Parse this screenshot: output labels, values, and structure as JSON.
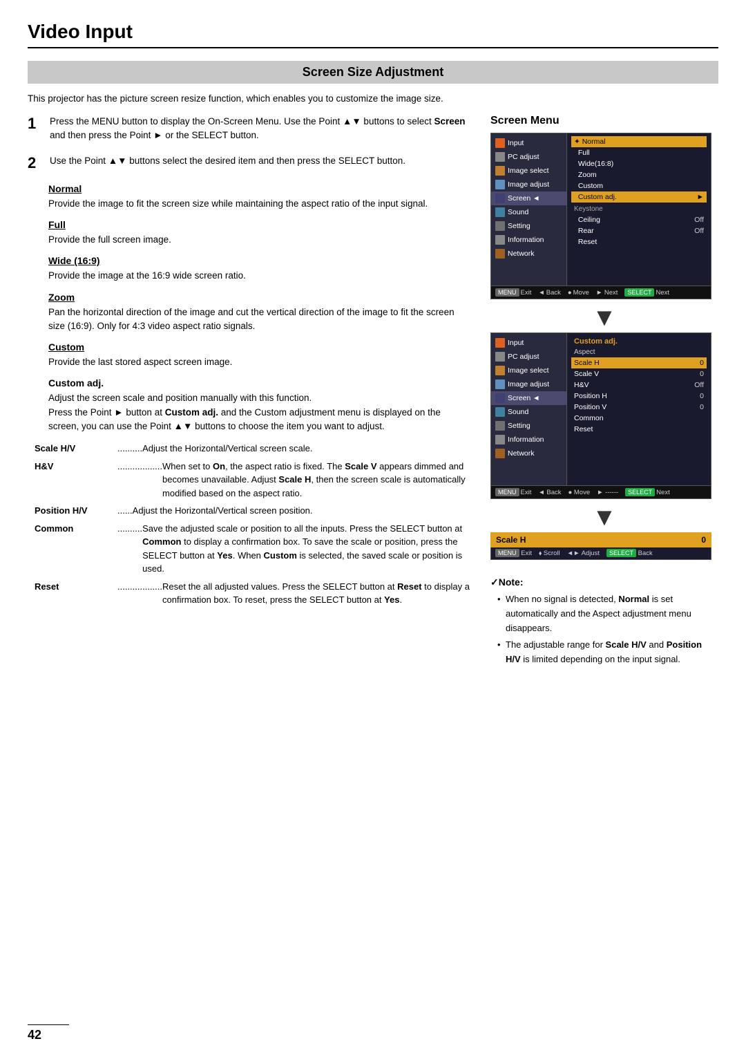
{
  "page": {
    "title": "Video Input",
    "page_number": "42",
    "section_header": "Screen Size Adjustment",
    "intro": "This projector has the picture screen resize function, which enables you to customize the image size."
  },
  "steps": [
    {
      "number": "1",
      "text": "Press the MENU button to display the On-Screen Menu. Use the Point ▲▼ buttons to select Screen and then press the Point ► or the SELECT button."
    },
    {
      "number": "2",
      "text": "Use the Point ▲▼ buttons select the desired item and then press the SELECT button."
    }
  ],
  "subsections": [
    {
      "title": "Normal",
      "style": "underline",
      "body": "Provide the image to fit the screen size while maintaining the aspect ratio of the input signal."
    },
    {
      "title": "Full",
      "style": "underline",
      "body": "Provide the full screen image."
    },
    {
      "title": "Wide (16:9)",
      "style": "underline",
      "body": "Provide the image at the 16:9 wide screen ratio."
    },
    {
      "title": "Zoom",
      "style": "underline",
      "body": "Pan the horizontal direction of the image and cut the vertical direction of the image to fit the screen size (16:9). Only for 4:3 video aspect ratio signals."
    },
    {
      "title": "Custom",
      "style": "underline",
      "body": "Provide the last stored aspect screen image."
    },
    {
      "title": "Custom adj.",
      "style": "bold",
      "body": "Adjust the screen scale and position manually with this function.\nPress the Point ► button at Custom adj. and the Custom adjustment menu is displayed on the screen, you can use the Point ▲▼ buttons to choose the item you want to adjust."
    }
  ],
  "def_list": [
    {
      "term": "Scale H/V",
      "dots": " ..........",
      "desc": "Adjust the Horizontal/Vertical screen scale."
    },
    {
      "term": "H&V",
      "dots": " ..................",
      "desc": "When set to On, the aspect ratio is fixed. The Scale V appears dimmed and becomes unavailable. Adjust Scale H, then the screen scale is automatically modified based on the aspect ratio."
    },
    {
      "term": "Position H/V",
      "dots": " .....",
      "desc": "Adjust the Horizontal/Vertical screen position."
    },
    {
      "term": "Common",
      "dots": " ..........",
      "desc": "Save the adjusted scale or position to all the inputs. Press the SELECT button at Common to display a confirmation box. To save the scale or position, press the SELECT button at Yes. When Custom is selected, the saved scale or position is used."
    },
    {
      "term": "Reset",
      "dots": " ..................",
      "desc": "Reset the all adjusted values. Press the SELECT button at Reset to display a confirmation box. To reset, press the SELECT button at Yes."
    }
  ],
  "screen_menu": {
    "title": "Screen Menu",
    "menu1": {
      "left_items": [
        {
          "label": "Input",
          "icon": "input"
        },
        {
          "label": "PC adjust",
          "icon": "pc"
        },
        {
          "label": "Image select",
          "icon": "image"
        },
        {
          "label": "Image adjust",
          "icon": "adjust"
        },
        {
          "label": "Screen",
          "icon": "screen",
          "active": true
        },
        {
          "label": "Sound",
          "icon": "sound"
        },
        {
          "label": "Setting",
          "icon": "setting"
        },
        {
          "label": "Information",
          "icon": "info"
        },
        {
          "label": "Network",
          "icon": "network"
        }
      ],
      "right_items": [
        {
          "label": "Normal",
          "selected": true
        },
        {
          "label": "Full"
        },
        {
          "label": "Wide(16:8)"
        },
        {
          "label": "Zoom"
        },
        {
          "label": "Custom"
        },
        {
          "label": "Custom adj.",
          "submenu": true
        },
        {
          "label": "Keystone",
          "section": true
        },
        {
          "label": "Ceiling",
          "value": "Off"
        },
        {
          "label": "Rear",
          "value": "Off"
        },
        {
          "label": "Reset"
        }
      ],
      "footer": [
        {
          "key": "MENU",
          "action": "Exit"
        },
        {
          "key": "◄Back",
          "action": ""
        },
        {
          "key": "●",
          "action": "Move"
        },
        {
          "key": "►",
          "action": "Next"
        },
        {
          "key": "SELECT",
          "action": "Next"
        }
      ]
    },
    "menu2": {
      "header": "Custom adj.",
      "subheader": "Aspect",
      "right_items": [
        {
          "label": "Scale H",
          "value": "0",
          "highlight": true
        },
        {
          "label": "Scale V",
          "value": "0"
        },
        {
          "label": "H&V",
          "value": "Off"
        },
        {
          "label": "Position H",
          "value": "0"
        },
        {
          "label": "Position V",
          "value": "0"
        },
        {
          "label": "Common"
        },
        {
          "label": "Reset"
        }
      ]
    },
    "scale_h_bar": {
      "label": "Scale H",
      "value": "0"
    },
    "scale_h_footer": [
      {
        "key": "MENU",
        "action": "Exit"
      },
      {
        "key": "⬧",
        "action": "Scroll"
      },
      {
        "key": "◄►",
        "action": "Adjust"
      },
      {
        "key": "SELECT",
        "action": "Back"
      }
    ]
  },
  "note": {
    "title": "✓Note:",
    "items": [
      "When no signal is detected, Normal is set automatically and the Aspect adjustment menu disappears.",
      "The adjustable range for Scale H/V and Position H/V is limited depending on the input signal."
    ]
  }
}
